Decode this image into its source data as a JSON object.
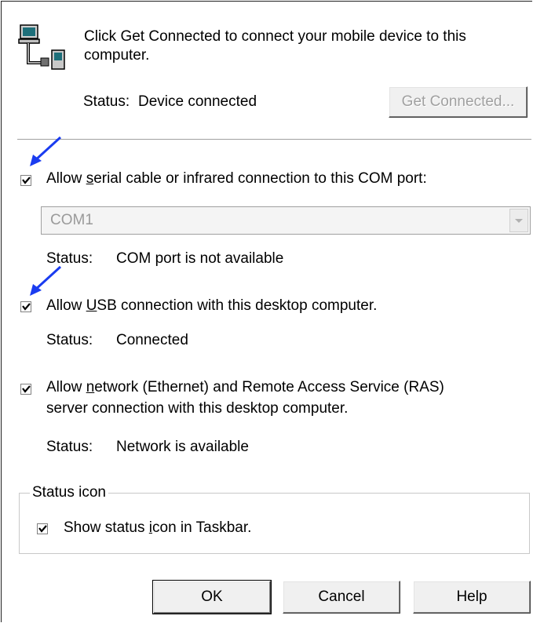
{
  "intro": {
    "message": "Click Get Connected to connect your mobile device to this computer.",
    "status_label": "Status:",
    "status_value": "Device connected",
    "get_connected_label": "Get Connected..."
  },
  "serial": {
    "checked": true,
    "label_pre": "Allow ",
    "label_key": "s",
    "label_post": "erial cable or infrared connection to this COM port:",
    "port_value": "COM1",
    "status_label": "Status:",
    "status_value": "COM port is not available"
  },
  "usb": {
    "checked": true,
    "label_pre": "Allow ",
    "label_key": "U",
    "label_post": "SB connection with this desktop computer.",
    "status_label": "Status:",
    "status_value": "Connected"
  },
  "network": {
    "checked": true,
    "label_pre": "Allow ",
    "label_key": "n",
    "label_post": "etwork (Ethernet) and Remote Access Service (RAS)",
    "label_line2": "server connection with this desktop computer.",
    "status_label": "Status:",
    "status_value": "Network is available"
  },
  "status_icon_group": {
    "title": "Status icon",
    "checked": true,
    "label_pre": "Show status ",
    "label_key": "i",
    "label_post": "con in Taskbar."
  },
  "buttons": {
    "ok": "OK",
    "cancel": "Cancel",
    "help": "Help"
  },
  "colors": {
    "annotation_arrow": "#1a3cf0",
    "disabled_text": "#a0a0a0"
  }
}
